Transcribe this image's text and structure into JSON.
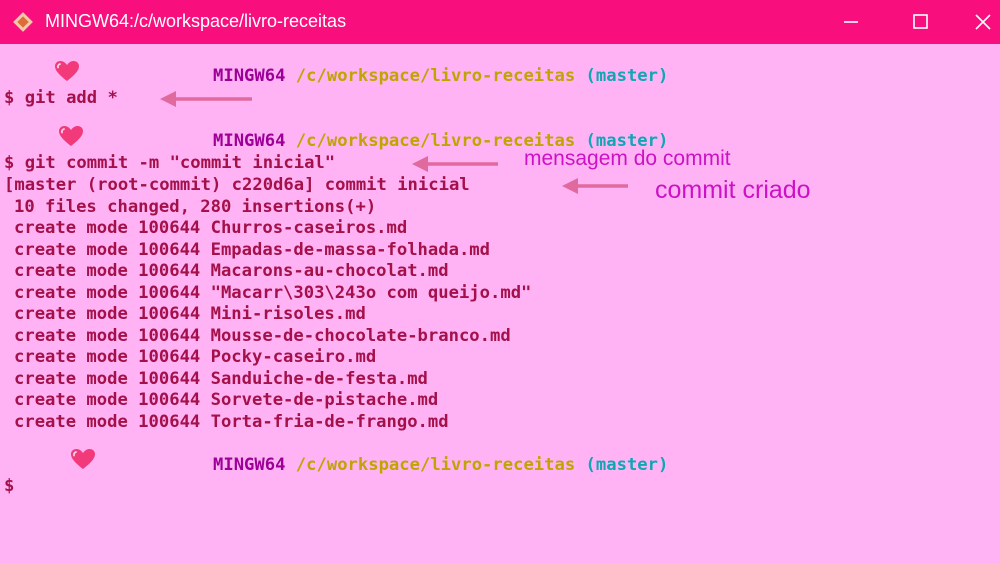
{
  "window": {
    "title": "MINGW64:/c/workspace/livro-receitas",
    "icons": {
      "app": "git-bash-icon",
      "minimize": "minimize-icon",
      "maximize": "maximize-icon",
      "close": "close-icon"
    },
    "colors": {
      "titlebar": "#f80f7d",
      "background": "#ffb3f5",
      "text": "#a4104a",
      "user": "#9c0096",
      "path": "#bea500",
      "branch": "#10a6b4",
      "annotation": "#cc12c5",
      "arrow": "#e0699e"
    }
  },
  "prompt": {
    "user": "MINGW64",
    "path": "/c/workspace/livro-receitas",
    "branch": "(master)",
    "symbol": "$",
    "decoration_icon": "heart-icon"
  },
  "terminal": {
    "cmd_add": "$ git add *",
    "cmd_commit": "$ git commit -m \"commit inicial\"",
    "commit_result": "[master (root-commit) c220d6a] commit inicial",
    "summary": "10 files changed, 280 insertions(+)",
    "create_lines": [
      "create mode 100644 Churros-caseiros.md",
      "create mode 100644 Empadas-de-massa-folhada.md",
      "create mode 100644 Macarons-au-chocolat.md",
      "create mode 100644 \"Macarr\\303\\243o com queijo.md\"",
      "create mode 100644 Mini-risoles.md",
      "create mode 100644 Mousse-de-chocolate-branco.md",
      "create mode 100644 Pocky-caseiro.md",
      "create mode 100644 Sanduiche-de-festa.md",
      "create mode 100644 Sorvete-de-pistache.md",
      "create mode 100644 Torta-fria-de-frango.md"
    ],
    "final_prompt_symbol": "$"
  },
  "annotations": {
    "commit_message": "mensagem do commit",
    "commit_created": "commit criado"
  }
}
